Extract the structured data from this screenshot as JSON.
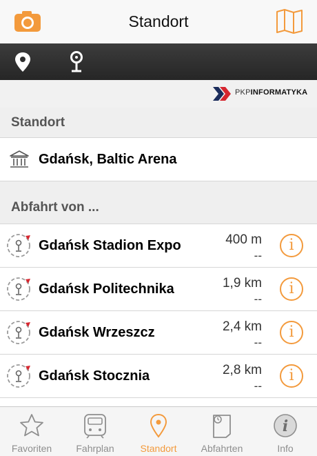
{
  "nav": {
    "title": "Standort",
    "left_icon": "camera-icon",
    "right_icon": "map-icon",
    "accent": "#f39a3c"
  },
  "toolbar": {
    "items": [
      "location-pin-icon",
      "station-pin-icon"
    ]
  },
  "brand": {
    "text_thin": "PKP",
    "text_bold": "INFORMATYKA"
  },
  "location_section": {
    "header": "Standort",
    "current": {
      "name": "Gdańsk, Baltic Arena",
      "icon": "landmark-icon"
    }
  },
  "departures_section": {
    "header": "Abfahrt von ...",
    "stations": [
      {
        "name": "Gdańsk Stadion Expo",
        "distance": "400 m",
        "sub": "--"
      },
      {
        "name": "Gdańsk Politechnika",
        "distance": "1,9 km",
        "sub": "--"
      },
      {
        "name": "Gdańsk Wrzeszcz",
        "distance": "2,4 km",
        "sub": "--"
      },
      {
        "name": "Gdańsk Stocznia",
        "distance": "2,8 km",
        "sub": "--"
      }
    ]
  },
  "tabbar": {
    "tabs": [
      {
        "label": "Favoriten",
        "icon": "star-icon",
        "active": false
      },
      {
        "label": "Fahrplan",
        "icon": "train-icon",
        "active": false
      },
      {
        "label": "Standort",
        "icon": "location-pin-icon",
        "active": true
      },
      {
        "label": "Abfahrten",
        "icon": "clock-document-icon",
        "active": false
      },
      {
        "label": "Info",
        "icon": "info-icon",
        "active": false
      }
    ]
  }
}
